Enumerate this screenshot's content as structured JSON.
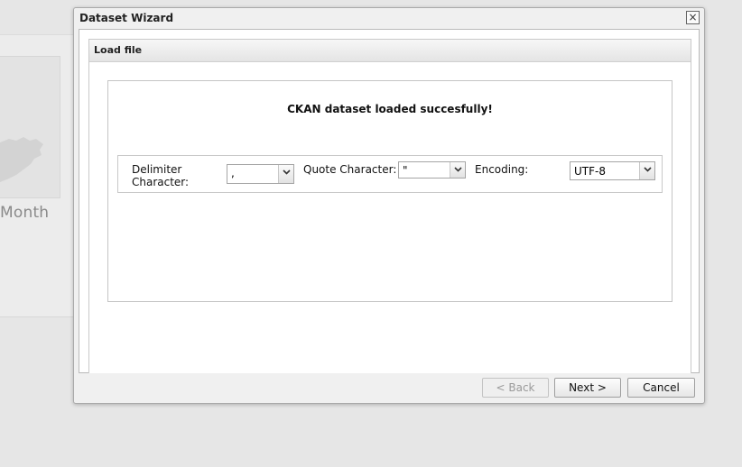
{
  "background": {
    "label": "Month"
  },
  "dialog": {
    "title": "Dataset Wizard",
    "close_icon": "close-icon",
    "section_title": "Load file",
    "message": "CKAN dataset loaded succesfully!",
    "delimiter": {
      "label": "Delimiter Character:",
      "value": ","
    },
    "quote": {
      "label": "Quote Character:",
      "value": "\""
    },
    "encoding": {
      "label": "Encoding:",
      "value": "UTF-8"
    },
    "buttons": {
      "back": "< Back",
      "next": "Next >",
      "cancel": "Cancel"
    }
  }
}
